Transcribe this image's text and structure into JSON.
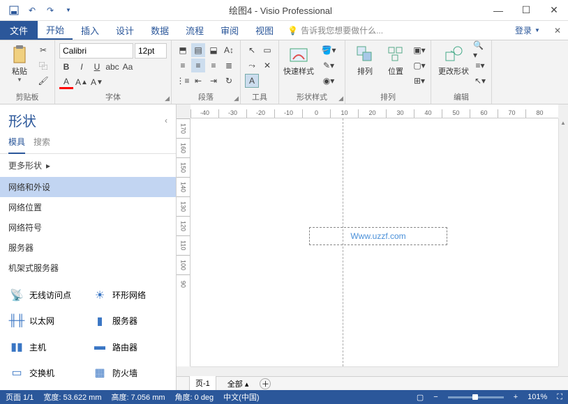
{
  "title": "绘图4 - Visio Professional",
  "tabs": {
    "file": "文件",
    "home": "开始",
    "insert": "插入",
    "design": "设计",
    "data": "数据",
    "process": "流程",
    "review": "审阅",
    "view": "视图"
  },
  "tellme": "告诉我您想要做什么...",
  "login": "登录",
  "ribbon": {
    "clipboard": {
      "label": "剪贴板",
      "paste": "粘贴"
    },
    "font": {
      "label": "字体",
      "name": "Calibri",
      "size": "12pt"
    },
    "paragraph": {
      "label": "段落"
    },
    "tools": {
      "label": "工具"
    },
    "shapestyles": {
      "label": "形状样式",
      "quick": "快速样式"
    },
    "arrange": {
      "label": "排列",
      "align": "排列",
      "position": "位置"
    },
    "edit": {
      "label": "编辑",
      "change": "更改形状"
    }
  },
  "shapes": {
    "title": "形状",
    "tab_stencil": "模具",
    "tab_search": "搜索",
    "more": "更多形状",
    "cats": [
      "网络和外设",
      "网络位置",
      "网络符号",
      "服务器",
      "机架式服务器"
    ],
    "items": [
      {
        "label": "无线访问点",
        "icon": "📡"
      },
      {
        "label": "环形网络",
        "icon": "☀"
      },
      {
        "label": "以太网",
        "icon": "╫╫"
      },
      {
        "label": "服务器",
        "icon": "▮"
      },
      {
        "label": "主机",
        "icon": "▮▮"
      },
      {
        "label": "路由器",
        "icon": "▬"
      },
      {
        "label": "交换机",
        "icon": "▭"
      },
      {
        "label": "防火墙",
        "icon": "▦"
      }
    ]
  },
  "ruler_h": [
    "-40",
    "-30",
    "-20",
    "-10",
    "0",
    "10",
    "20",
    "30",
    "40",
    "50",
    "60",
    "70",
    "80"
  ],
  "ruler_v": [
    "170",
    "160",
    "150",
    "140",
    "130",
    "120",
    "110",
    "100",
    "90"
  ],
  "selection_text": "Www.uzzf.com",
  "sheet": {
    "page": "页-1",
    "all": "全部",
    "add": "+"
  },
  "status": {
    "page": "页面 1/1",
    "width": "宽度: 53.622 mm",
    "height": "高度: 7.056 mm",
    "angle": "角度: 0 deg",
    "lang": "中文(中国)",
    "zoom": "101%"
  }
}
